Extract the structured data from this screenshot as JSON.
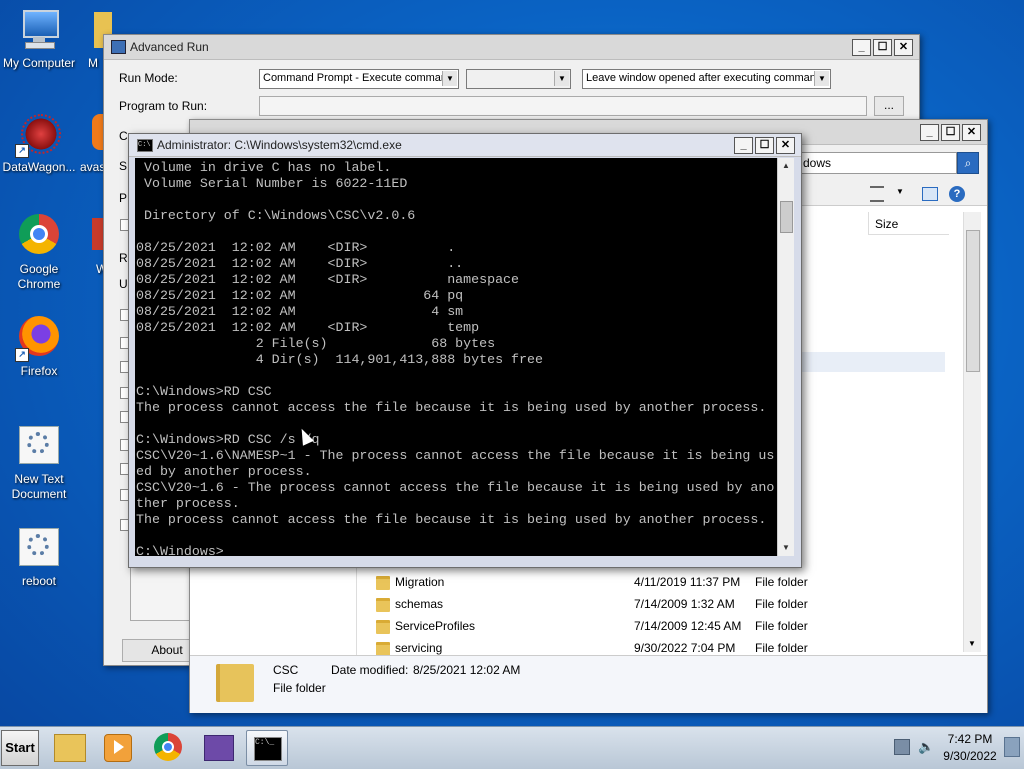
{
  "desktop": {
    "icons": [
      {
        "label": "My Computer"
      },
      {
        "label": "M"
      },
      {
        "label": "DataWagon..."
      },
      {
        "label": "avas"
      },
      {
        "label": "Google Chrome"
      },
      {
        "label": "W"
      },
      {
        "label": "Firefox"
      },
      {
        "label": "New Text Document"
      },
      {
        "label": "reboot"
      }
    ]
  },
  "advanced_run": {
    "title": "Advanced Run",
    "run_mode_label": "Run Mode:",
    "run_mode_value": "Command Prompt - Execute command",
    "window_option_value": "Leave window opened after executing command",
    "program_label": "Program to Run:",
    "browse_label": "...",
    "about_label": "About",
    "hidden_labels": [
      "C",
      "S",
      "P",
      "R",
      "U"
    ]
  },
  "explorer": {
    "search_text": "dows",
    "size_header": "Size",
    "files": [
      {
        "name": "Migration",
        "date": "4/11/2019 11:37 PM",
        "type": "File folder"
      },
      {
        "name": "schemas",
        "date": "7/14/2009 1:32 AM",
        "type": "File folder"
      },
      {
        "name": "ServiceProfiles",
        "date": "7/14/2009 12:45 AM",
        "type": "File folder"
      },
      {
        "name": "servicing",
        "date": "9/30/2022 7:04 PM",
        "type": "File folder"
      }
    ],
    "details": {
      "name": "CSC",
      "date_modified_label": "Date modified:",
      "date_modified": "8/25/2021 12:02 AM",
      "type": "File folder"
    }
  },
  "cmd": {
    "title": "Administrator: C:\\Windows\\system32\\cmd.exe",
    "output": " Volume in drive C has no label.\n Volume Serial Number is 6022-11ED\n\n Directory of C:\\Windows\\CSC\\v2.0.6\n\n08/25/2021  12:02 AM    <DIR>          .\n08/25/2021  12:02 AM    <DIR>          ..\n08/25/2021  12:02 AM    <DIR>          namespace\n08/25/2021  12:02 AM                64 pq\n08/25/2021  12:02 AM                 4 sm\n08/25/2021  12:02 AM    <DIR>          temp\n               2 File(s)             68 bytes\n               4 Dir(s)  114,901,413,888 bytes free\n\nC:\\Windows>RD CSC\nThe process cannot access the file because it is being used by another process.\n\nC:\\Windows>RD CSC /s /q\nCSC\\V20~1.6\\NAMESP~1 - The process cannot access the file because it is being us\ned by another process.\nCSC\\V20~1.6 - The process cannot access the file because it is being used by ano\nther process.\nThe process cannot access the file because it is being used by another process.\n\nC:\\Windows>_"
  },
  "taskbar": {
    "start_label": "Start",
    "time": "7:42 PM",
    "date": "9/30/2022"
  },
  "colors": {
    "desktop": "#0a63c4",
    "console_bg": "#000000",
    "console_fg": "#c0c0c0"
  }
}
